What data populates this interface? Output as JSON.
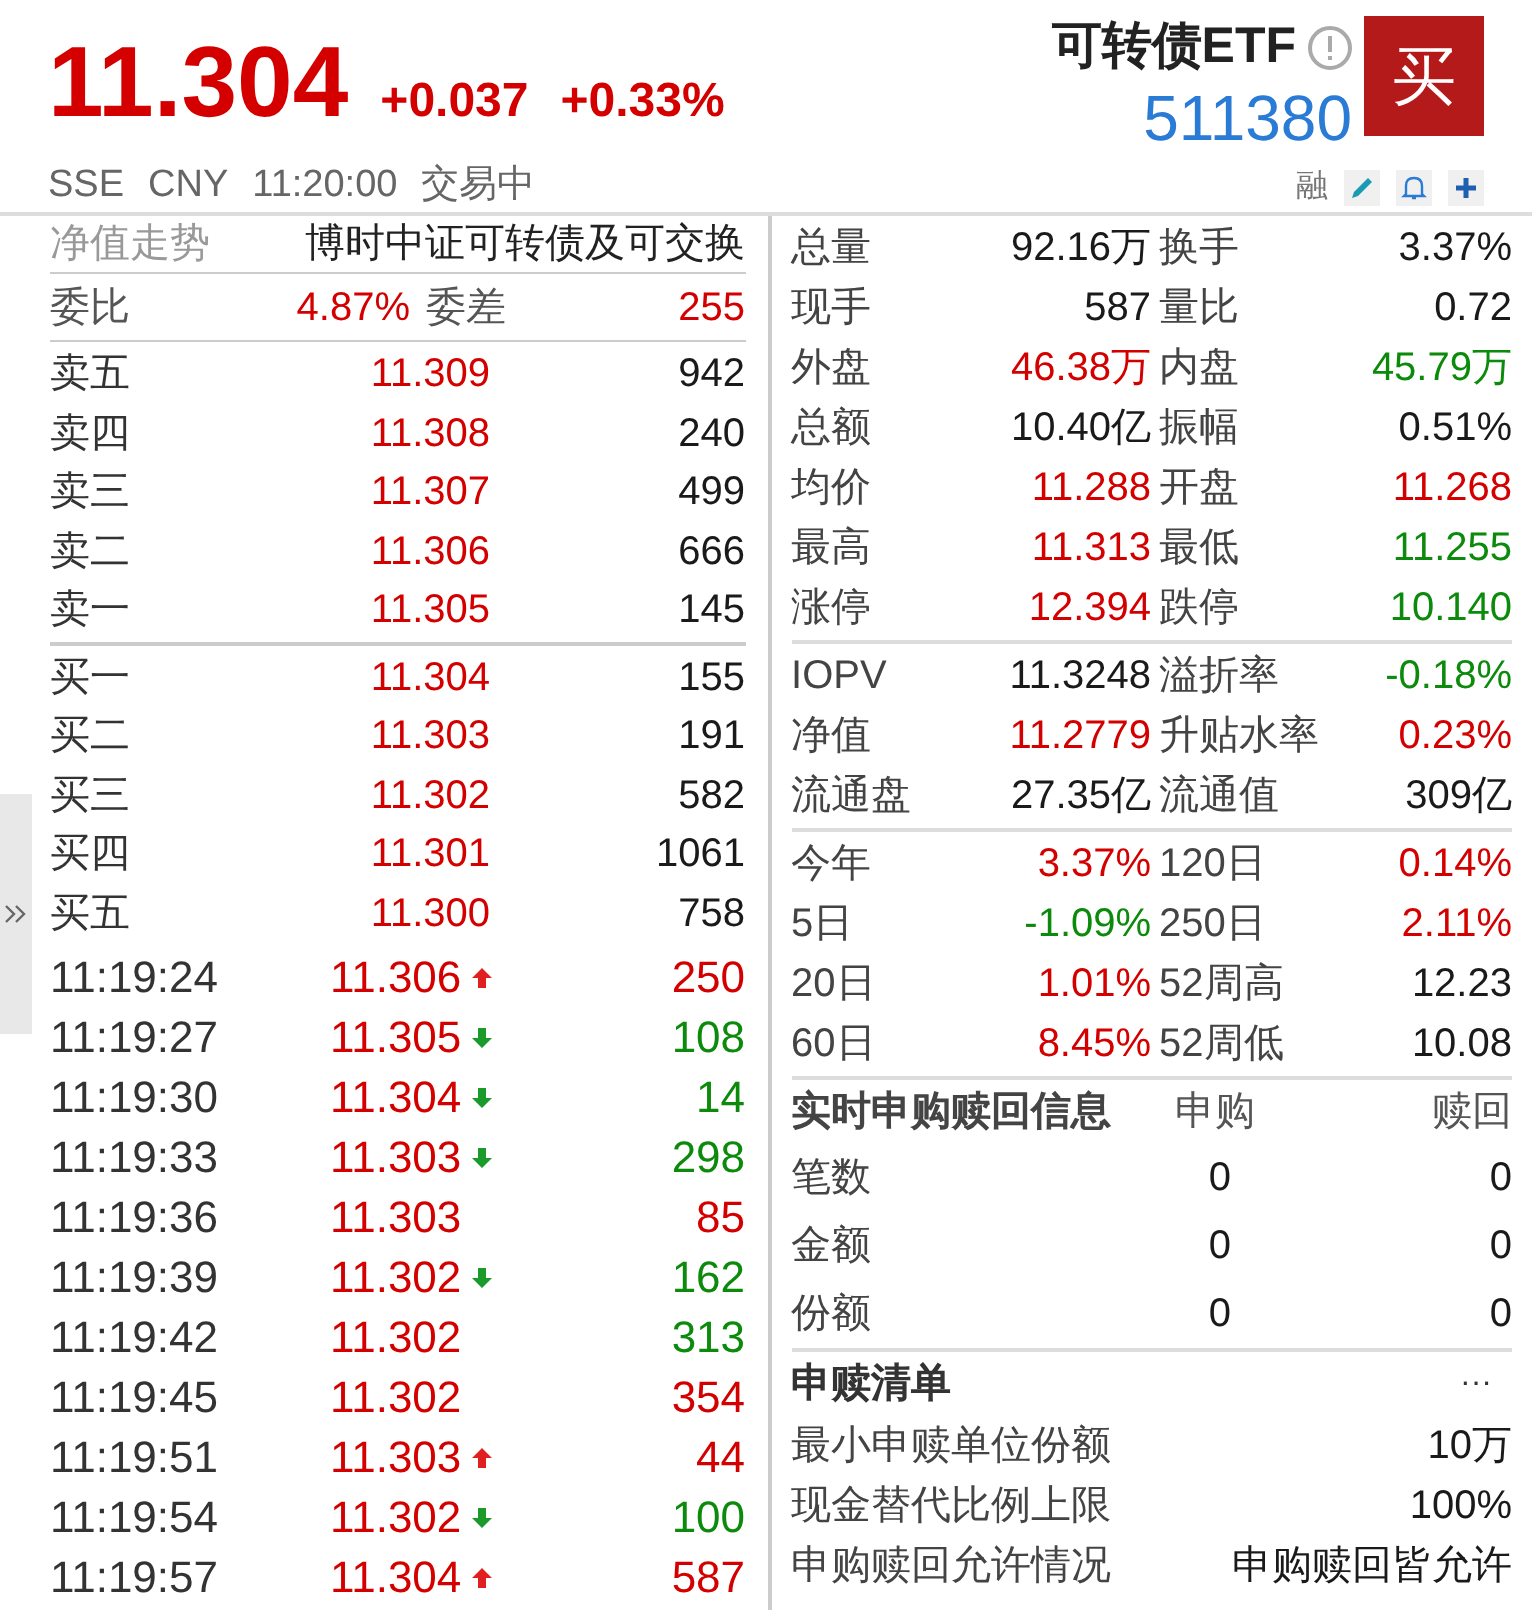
{
  "header": {
    "price": "11.304",
    "change": "+0.037",
    "change_pct": "+0.33%",
    "name": "可转债ETF",
    "code": "511380",
    "buy_button": "买",
    "exchange": "SSE",
    "currency": "CNY",
    "time": "11:20:00",
    "status": "交易中",
    "margin_tag": "融"
  },
  "left_panel": {
    "tab": "净值走势",
    "index_name": "博时中证可转债及可交换",
    "ratio": {
      "label": "委比",
      "value": "4.87%",
      "diff_label": "委差",
      "diff_value": "255"
    },
    "asks": [
      {
        "label": "卖五",
        "price": "11.309",
        "volume": "942"
      },
      {
        "label": "卖四",
        "price": "11.308",
        "volume": "240"
      },
      {
        "label": "卖三",
        "price": "11.307",
        "volume": "499"
      },
      {
        "label": "卖二",
        "price": "11.306",
        "volume": "666"
      },
      {
        "label": "卖一",
        "price": "11.305",
        "volume": "145"
      }
    ],
    "bids": [
      {
        "label": "买一",
        "price": "11.304",
        "volume": "155"
      },
      {
        "label": "买二",
        "price": "11.303",
        "volume": "191"
      },
      {
        "label": "买三",
        "price": "11.302",
        "volume": "582"
      },
      {
        "label": "买四",
        "price": "11.301",
        "volume": "1061"
      },
      {
        "label": "买五",
        "price": "11.300",
        "volume": "758"
      }
    ],
    "ticks": [
      {
        "time": "11:19:24",
        "price": "11.306",
        "kind": "up",
        "volume": "250",
        "color": "#d40000"
      },
      {
        "time": "11:19:27",
        "price": "11.305",
        "kind": "down",
        "volume": "108",
        "color": "#0b8a0b"
      },
      {
        "time": "11:19:30",
        "price": "11.304",
        "kind": "down",
        "volume": "14",
        "color": "#0b8a0b"
      },
      {
        "time": "11:19:33",
        "price": "11.303",
        "kind": "down",
        "volume": "298",
        "color": "#0b8a0b"
      },
      {
        "time": "11:19:36",
        "price": "11.303",
        "kind": "flat",
        "volume": "85",
        "color": "#d40000"
      },
      {
        "time": "11:19:39",
        "price": "11.302",
        "kind": "down",
        "volume": "162",
        "color": "#0b8a0b"
      },
      {
        "time": "11:19:42",
        "price": "11.302",
        "kind": "flat",
        "volume": "313",
        "color": "#0b8a0b"
      },
      {
        "time": "11:19:45",
        "price": "11.302",
        "kind": "flat",
        "volume": "354",
        "color": "#d40000"
      },
      {
        "time": "11:19:51",
        "price": "11.303",
        "kind": "up",
        "volume": "44",
        "color": "#d40000"
      },
      {
        "time": "11:19:54",
        "price": "11.302",
        "kind": "down",
        "volume": "100",
        "color": "#0b8a0b"
      },
      {
        "time": "11:19:57",
        "price": "11.304",
        "kind": "up",
        "volume": "587",
        "color": "#d40000"
      }
    ]
  },
  "right_panel": {
    "sections": [
      [
        [
          {
            "label": "总量",
            "value": "92.16万",
            "color": "#1a1a1a"
          },
          {
            "label": "换手",
            "value": "3.37%",
            "color": "#1a1a1a"
          }
        ],
        [
          {
            "label": "现手",
            "value": "587",
            "color": "#1a1a1a"
          },
          {
            "label": "量比",
            "value": "0.72",
            "color": "#1a1a1a"
          }
        ],
        [
          {
            "label": "外盘",
            "value": "46.38万",
            "color": "#d40000"
          },
          {
            "label": "内盘",
            "value": "45.79万",
            "color": "#0b8a0b"
          }
        ],
        [
          {
            "label": "总额",
            "value": "10.40亿",
            "color": "#1a1a1a"
          },
          {
            "label": "振幅",
            "value": "0.51%",
            "color": "#1a1a1a"
          }
        ],
        [
          {
            "label": "均价",
            "value": "11.288",
            "color": "#d40000"
          },
          {
            "label": "开盘",
            "value": "11.268",
            "color": "#d40000"
          }
        ],
        [
          {
            "label": "最高",
            "value": "11.313",
            "color": "#d40000"
          },
          {
            "label": "最低",
            "value": "11.255",
            "color": "#0b8a0b"
          }
        ],
        [
          {
            "label": "涨停",
            "value": "12.394",
            "color": "#d40000"
          },
          {
            "label": "跌停",
            "value": "10.140",
            "color": "#0b8a0b"
          }
        ]
      ],
      [
        [
          {
            "label": "IOPV",
            "value": "11.3248",
            "color": "#1a1a1a"
          },
          {
            "label": "溢折率",
            "value": "-0.18%",
            "color": "#0b8a0b"
          }
        ],
        [
          {
            "label": "净值",
            "value": "11.2779",
            "color": "#d40000"
          },
          {
            "label": "升贴水率",
            "value": "0.23%",
            "color": "#d40000"
          }
        ],
        [
          {
            "label": "流通盘",
            "value": "27.35亿",
            "color": "#1a1a1a"
          },
          {
            "label": "流通值",
            "value": "309亿",
            "color": "#1a1a1a"
          }
        ]
      ],
      [
        [
          {
            "label": "今年",
            "value": "3.37%",
            "color": "#d40000"
          },
          {
            "label": "120日",
            "value": "0.14%",
            "color": "#d40000"
          }
        ],
        [
          {
            "label": "5日",
            "value": "-1.09%",
            "color": "#0b8a0b"
          },
          {
            "label": "250日",
            "value": "2.11%",
            "color": "#d40000"
          }
        ],
        [
          {
            "label": "20日",
            "value": "1.01%",
            "color": "#d40000"
          },
          {
            "label": "52周高",
            "value": "12.23",
            "color": "#1a1a1a"
          }
        ],
        [
          {
            "label": "60日",
            "value": "8.45%",
            "color": "#d40000"
          },
          {
            "label": "52周低",
            "value": "10.08",
            "color": "#1a1a1a"
          }
        ]
      ]
    ],
    "subscription": {
      "title": "实时申购赎回信息",
      "columns": [
        "申购",
        "赎回"
      ],
      "rows": [
        {
          "label": "笔数",
          "values": [
            "0",
            "0"
          ]
        },
        {
          "label": "金额",
          "values": [
            "0",
            "0"
          ]
        },
        {
          "label": "份额",
          "values": [
            "0",
            "0"
          ]
        }
      ]
    },
    "list": {
      "title": "申赎清单",
      "more": "···",
      "rows": [
        {
          "label": "最小申赎单位份额",
          "value": "10万"
        },
        {
          "label": "现金替代比例上限",
          "value": "100%"
        },
        {
          "label": "申购赎回允许情况",
          "value": "申购赎回皆允许"
        }
      ]
    }
  }
}
